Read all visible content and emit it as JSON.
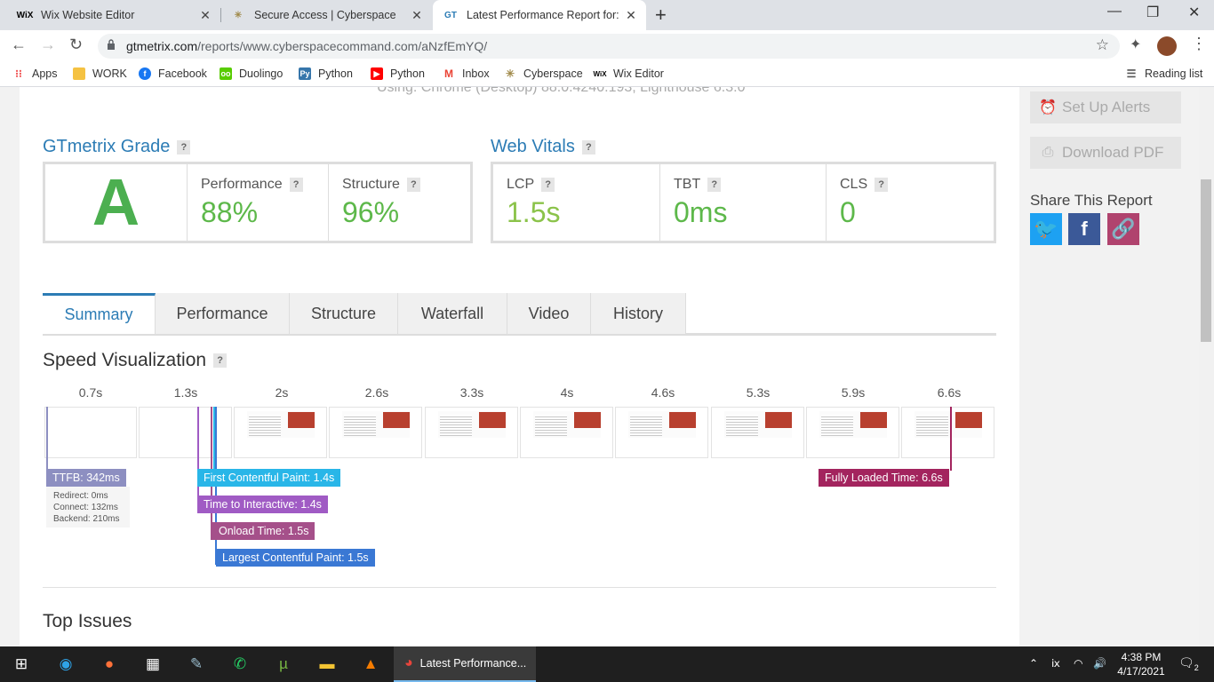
{
  "browser": {
    "tabs": [
      {
        "label": "Wix Website Editor",
        "icon": "wix-logo-icon"
      },
      {
        "label": "Secure Access | Cyberspace",
        "icon": "cyberspace-logo-icon"
      },
      {
        "label": "Latest Performance Report for: ht",
        "icon": "gtmetrix-logo-icon",
        "active": true
      }
    ],
    "url_domain": "gtmetrix.com",
    "url_path": "/reports/www.cyberspacecommand.com/aNzfEmYQ/",
    "bookmarks": [
      "Apps",
      "WORK",
      "Facebook",
      "Duolingo",
      "Python",
      "Python",
      "Inbox",
      "Cyberspace",
      "Wix Editor"
    ],
    "reading_list": "Reading list"
  },
  "report": {
    "using_text": "Using:    Chrome (Desktop) 88.0.4240.193, Lighthouse 6.3.0",
    "grade_title": "GTmetrix Grade",
    "grade": "A",
    "performance_label": "Performance",
    "performance_value": "88%",
    "structure_label": "Structure",
    "structure_value": "96%",
    "vitals_title": "Web Vitals",
    "lcp_label": "LCP",
    "lcp_value": "1.5s",
    "tbt_label": "TBT",
    "tbt_value": "0ms",
    "cls_label": "CLS",
    "cls_value": "0",
    "help": "?",
    "tabs": [
      "Summary",
      "Performance",
      "Structure",
      "Waterfall",
      "Video",
      "History"
    ],
    "speed_title": "Speed Visualization",
    "timeline_ticks": [
      "0.7s",
      "1.3s",
      "2s",
      "2.6s",
      "3.3s",
      "4s",
      "4.6s",
      "5.3s",
      "5.9s",
      "6.6s"
    ],
    "ttfb": "TTFB: 342ms",
    "redirect": "Redirect: 0ms",
    "connect": "Connect: 132ms",
    "backend": "Backend: 210ms",
    "fcp": "First Contentful Paint: 1.4s",
    "tti": "Time to Interactive: 1.4s",
    "onload": "Onload Time: 1.5s",
    "lcp_full": "Largest Contentful Paint: 1.5s",
    "fully_loaded": "Fully Loaded Time: 6.6s",
    "top_issues": "Top Issues"
  },
  "sidebar": {
    "alerts": "Set Up Alerts",
    "pdf": "Download PDF",
    "share": "Share This Report"
  },
  "taskbar": {
    "active_app": "Latest Performance...",
    "time": "4:38 PM",
    "date": "4/17/2021",
    "notifications": "2"
  },
  "colors": {
    "accent": "#2c7cb5",
    "grade_green": "#4caf50",
    "ttfb": "#8d8fc1",
    "fcp": "#29b6e8",
    "tti": "#a05bc4",
    "onload": "#a5508a",
    "lcp": "#3a78d4",
    "fully_loaded": "#a3245e"
  }
}
